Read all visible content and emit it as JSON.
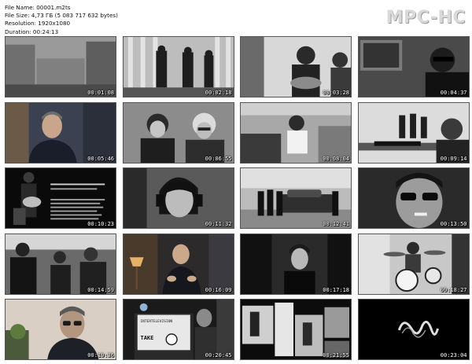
{
  "header": {
    "file_name": "File Name: 00001.m2ts",
    "file_size": "File Size: 4,73 ГБ (5 083 717 632 bytes)",
    "resolution": "Resolution: 1920x1080",
    "duration": "Duration: 00:24:13",
    "logo": "MPC-HC"
  },
  "thumbnails": [
    {
      "time": "00:01:08"
    },
    {
      "time": "00:02:18"
    },
    {
      "time": "00:03:28"
    },
    {
      "time": "00:04:37"
    },
    {
      "time": "00:05:46"
    },
    {
      "time": "00:06:55"
    },
    {
      "time": "00:08:04"
    },
    {
      "time": "00:09:14"
    },
    {
      "time": "00:10:23"
    },
    {
      "time": "00:11:32"
    },
    {
      "time": "00:12:41"
    },
    {
      "time": "00:13:50"
    },
    {
      "time": "00:14:59"
    },
    {
      "time": "00:16:09"
    },
    {
      "time": "00:17:18"
    },
    {
      "time": "00:18:27"
    },
    {
      "time": "00:19:36"
    },
    {
      "time": "00:20:45"
    },
    {
      "time": "00:21:55"
    },
    {
      "time": "00:23:04"
    }
  ],
  "thumbnail_text": {
    "t9_lines": [
      "I, ME, MINE, MY"
    ],
    "t18_sign": [
      "INTERTELEVISION",
      "TAKE"
    ]
  }
}
